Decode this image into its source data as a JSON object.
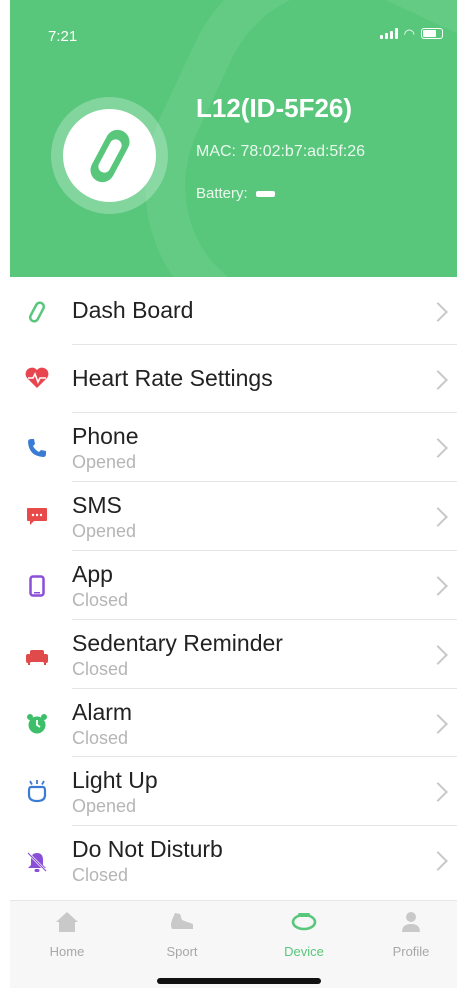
{
  "status": {
    "time": "7:21"
  },
  "device": {
    "name": "L12(ID-5F26)",
    "mac": "MAC: 78:02:b7:ad:5f:26",
    "battery_label": "Battery:"
  },
  "colors": {
    "accent": "#58c77b",
    "subtext": "#b5b5b5"
  },
  "menu": [
    {
      "title": "Dash Board",
      "subtitle": "",
      "icon": "band-icon"
    },
    {
      "title": "Heart Rate Settings",
      "subtitle": "",
      "icon": "heart-rate-icon"
    },
    {
      "title": "Phone",
      "subtitle": "Opened",
      "icon": "phone-icon"
    },
    {
      "title": "SMS",
      "subtitle": "Opened",
      "icon": "sms-icon"
    },
    {
      "title": "App",
      "subtitle": "Closed",
      "icon": "app-icon"
    },
    {
      "title": "Sedentary Reminder",
      "subtitle": "Closed",
      "icon": "sofa-icon"
    },
    {
      "title": "Alarm",
      "subtitle": "Closed",
      "icon": "alarm-clock-icon"
    },
    {
      "title": "Light Up",
      "subtitle": "Opened",
      "icon": "light-up-icon"
    },
    {
      "title": "Do Not Disturb",
      "subtitle": "Closed",
      "icon": "bell-off-icon"
    }
  ],
  "tabs": [
    {
      "label": "Home",
      "icon": "home-icon",
      "active": false
    },
    {
      "label": "Sport",
      "icon": "sport-shoe-icon",
      "active": false
    },
    {
      "label": "Device",
      "icon": "band-icon",
      "active": true
    },
    {
      "label": "Profile",
      "icon": "person-icon",
      "active": false
    }
  ]
}
